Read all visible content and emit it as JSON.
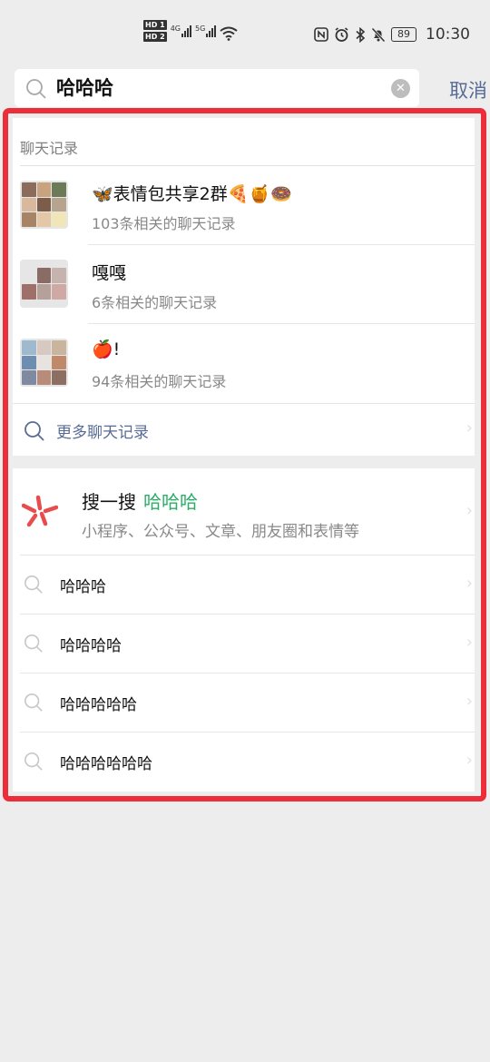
{
  "status_bar": {
    "sim1_badge": "HD 1",
    "sim2_badge": "HD 2",
    "sim1_network": "4G",
    "sim2_network": "5G",
    "battery": "89",
    "time": "10:30",
    "icons": [
      "nfc-icon",
      "alarm-icon",
      "bluetooth-icon",
      "mute-icon"
    ]
  },
  "search": {
    "query": "哈哈哈",
    "cancel_label": "取消"
  },
  "chat_records": {
    "section_title": "聊天记录",
    "items": [
      {
        "name": "🦋表情包共享2群🍕🍯🍩",
        "subtitle": "103条相关的聊天记录"
      },
      {
        "name": "嘎嘎",
        "subtitle": "6条相关的聊天记录"
      },
      {
        "name": "🍎!",
        "subtitle": "94条相关的聊天记录"
      }
    ],
    "more_label": "更多聊天记录"
  },
  "souyisou": {
    "title": "搜一搜",
    "keyword": "哈哈哈",
    "subtitle": "小程序、公众号、文章、朋友圈和表情等",
    "accent_color": "#2aae67",
    "icon_color": "#e84c4c"
  },
  "suggestions": [
    "哈哈哈",
    "哈哈哈哈",
    "哈哈哈哈哈",
    "哈哈哈哈哈哈"
  ],
  "colors": {
    "link": "#576b95",
    "annotation_frame": "#ec2d3a",
    "background": "#ededed"
  }
}
